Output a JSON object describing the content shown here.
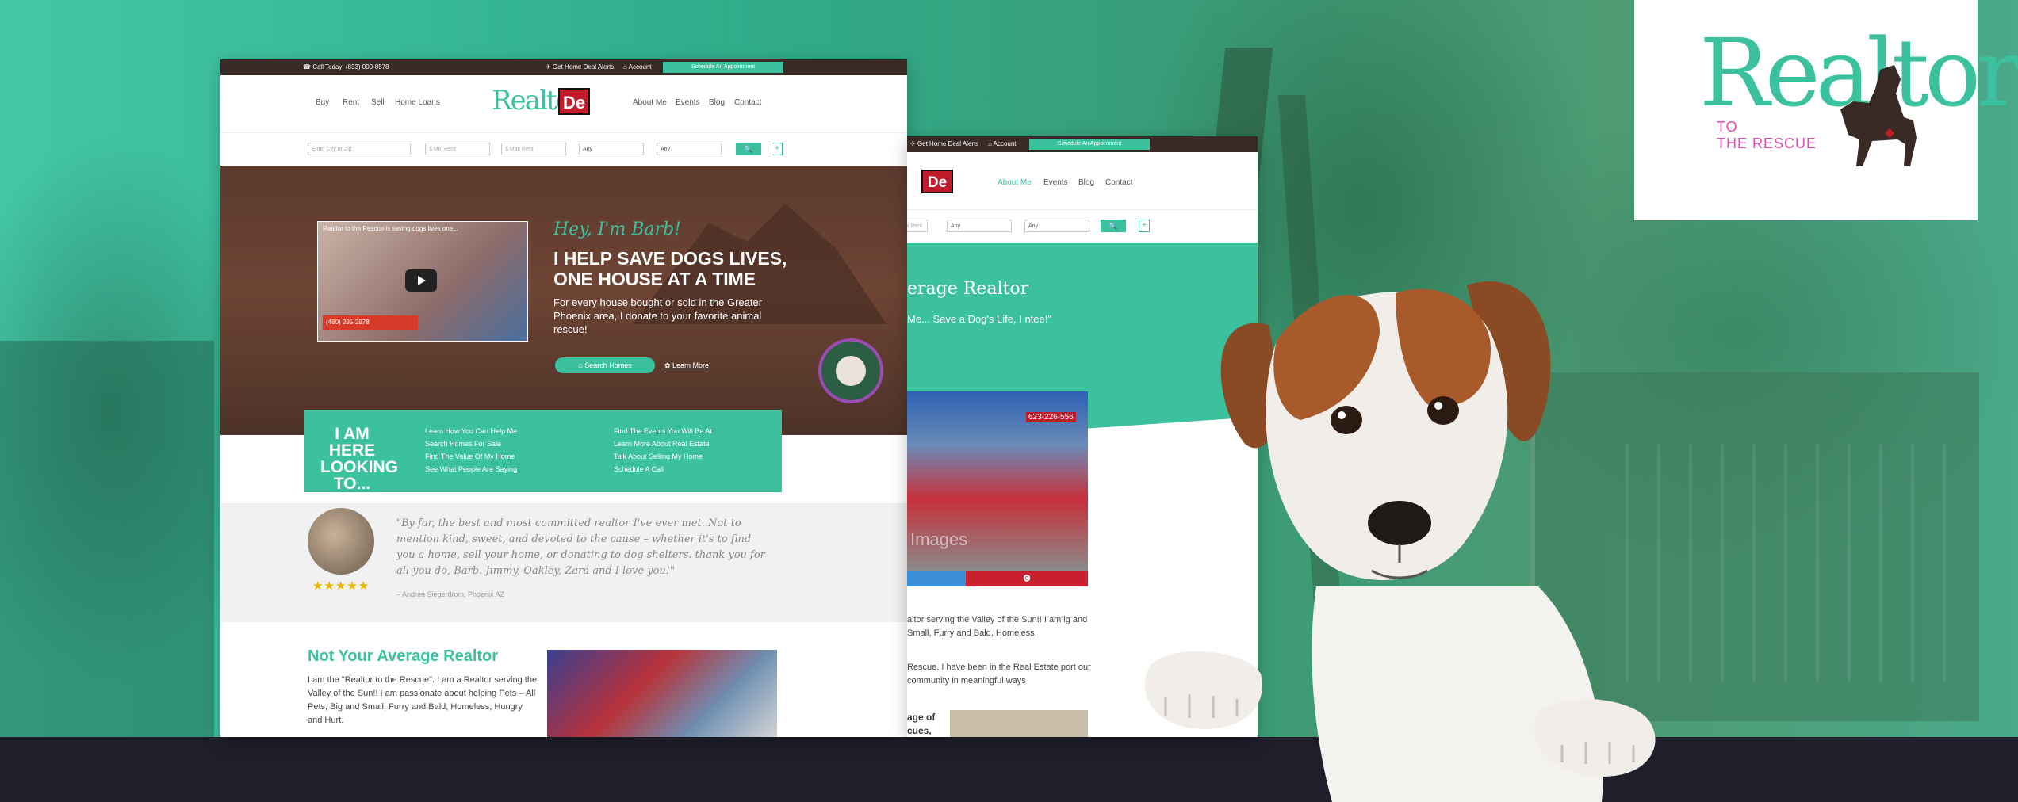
{
  "site1": {
    "topbar": {
      "call": "☎ Call Today: (833) 000-8578",
      "alerts": "✈ Get Home Deal Alerts",
      "account": "⌂ Account",
      "schedule": "Schedule An Appointment"
    },
    "nav_left": [
      "Buy",
      "Rent",
      "Sell",
      "Home Loans"
    ],
    "nav_right": [
      "About Me",
      "Events",
      "Blog",
      "Contact"
    ],
    "logo_text": "Realtor",
    "logo_de": "De",
    "search": {
      "city_placeholder": "Enter City or Zip",
      "min_placeholder": "$    Min Rent",
      "max_placeholder": "$    Max Rent",
      "beds": "Any",
      "baths": "Any",
      "button": "🔍",
      "plus": "+"
    },
    "hero": {
      "video_title": "Realtor to the Rescue is saving dogs lives one...",
      "video_banner": "(480) 295-2978",
      "greeting": "Hey, I'm Barb!",
      "headline": "I HELP SAVE DOGS LIVES, ONE HOUSE AT A TIME",
      "paragraph": "For every house bought or sold in the Greater Phoenix area, I donate to your favorite animal rescue!",
      "search_button": "⌂   Search Homes",
      "learn_more": "✿ Learn More"
    },
    "looking": {
      "heading": "I AM HERE LOOKING TO...",
      "col1": [
        "Learn How You Can Help Me",
        "Search Homes For Sale",
        "Find The Value Of My Home",
        "See What People Are Saying"
      ],
      "col2": [
        "Find The Events You Will Be At",
        "Learn More About Real Estate",
        "Talk About Selling My Home",
        "Schedule A Call"
      ]
    },
    "testimonial": {
      "stars": "★★★★★",
      "quote": "\"By far, the best and most committed realtor I've ever met. Not to mention kind, sweet, and devoted to the cause – whether it's to find you a home, sell your home, or donating to dog shelters. thank you for all you do, Barb. Jimmy, Oakley, Zara and I love you!\"",
      "author": "– Andrea Siegerdrom, Phoenix AZ"
    },
    "about": {
      "heading": "Not Your Average Realtor",
      "paragraph": "I am the \"Realtor to the Rescue\". I am a Realtor serving the Valley of the Sun!! I am passionate about helping Pets – All Pets, Big and Small, Furry and Bald, Homeless, Hungry and Hurt."
    }
  },
  "site2": {
    "topbar": {
      "alerts": "✈ Get Home Deal Alerts",
      "account": "⌂ Account",
      "schedule": "Schedule An Appointment"
    },
    "logo_de": "De",
    "nav": [
      "About Me",
      "Events",
      "Blog",
      "Contact"
    ],
    "search": {
      "max": "ax Rent",
      "f1": "Any",
      "f2": "Any",
      "button": "🔍",
      "plus": "+"
    },
    "hero_heading": "erage Realtor",
    "hero_paragraph": "Me... Save a Dog's Life, I ntee!\"",
    "photo_phone": "623-226-556",
    "photo_watermark": "Images",
    "share_icon": "⓿",
    "text1": "altor serving the Valley of the Sun!! I am ig and Small, Furry and Bald, Homeless,",
    "text2": "Rescue. I have been in the Real Estate port our community in meaningful ways",
    "bold": "age of cues,"
  },
  "logo_card": {
    "realtor": "Realtor",
    "to": "TO",
    "the_rescue": "THE RESCUE"
  },
  "colors": {
    "teal": "#3cc19f",
    "brown": "#3a2a25",
    "red": "#c21b2c",
    "pink": "#e04bb0",
    "dark": "#1e1f2b"
  }
}
